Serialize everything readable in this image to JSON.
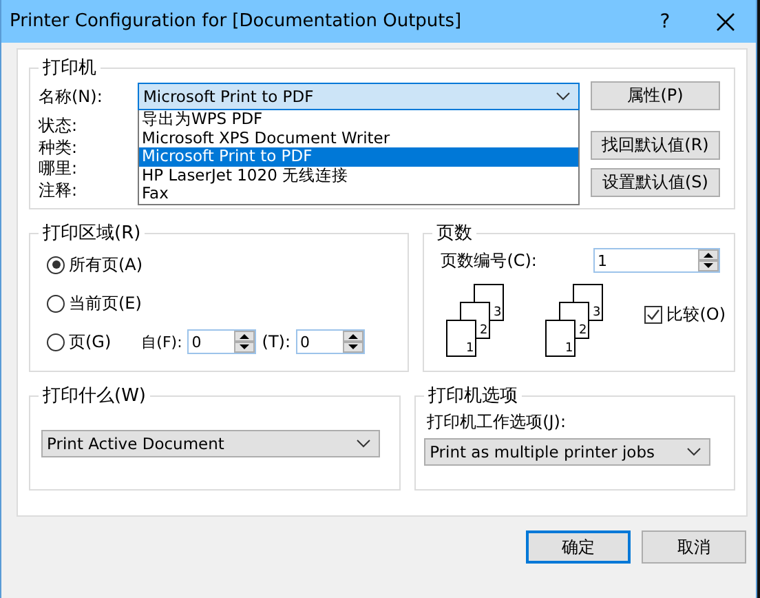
{
  "window": {
    "title": "Printer Configuration for [Documentation Outputs]",
    "help": "?"
  },
  "printer": {
    "title": "打印机",
    "name_label": "名称(N):",
    "name_value": "Microsoft Print to PDF",
    "options": [
      {
        "label": "导出为WPS PDF",
        "selected": false
      },
      {
        "label": "Microsoft XPS Document Writer",
        "selected": false
      },
      {
        "label": "Microsoft Print to PDF",
        "selected": true
      },
      {
        "label": "HP LaserJet 1020 无线连接",
        "selected": false
      },
      {
        "label": "Fax",
        "selected": false
      }
    ],
    "info_labels": [
      "状态:",
      "种类:",
      "哪里:",
      "注释:"
    ],
    "properties_button": "属性(P)",
    "restore_button": "找回默认值(R)",
    "set_default_button": "设置默认值(S)"
  },
  "print_range": {
    "title": "打印区域(R)",
    "options": [
      {
        "label": "所有页(A)",
        "selected": true
      },
      {
        "label": "当前页(E)",
        "selected": false
      },
      {
        "label": "页(G)",
        "selected": false
      }
    ],
    "from_label": "自(F):",
    "from_value": "0",
    "to_label": "(T):",
    "to_value": "0"
  },
  "copies": {
    "title": "页数",
    "count_label": "页数编号(C):",
    "count_value": "1",
    "stacks": [
      [
        "3",
        "2",
        "1"
      ],
      [
        "3",
        "2",
        "1"
      ]
    ],
    "collate": {
      "label": "比较(O)",
      "checked": true
    }
  },
  "print_what": {
    "title": "打印什么(W)",
    "value": "Print Active Document"
  },
  "printer_options": {
    "title": "打印机选项",
    "label": "打印机工作选项(J):",
    "value": "Print as multiple printer jobs"
  },
  "buttons": [
    {
      "label": "确定",
      "default": true
    },
    {
      "label": "取消",
      "default": false
    }
  ]
}
